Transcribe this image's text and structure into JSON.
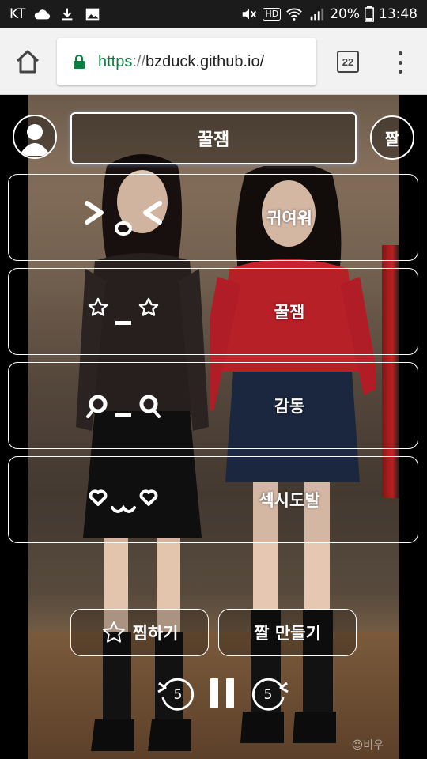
{
  "status_bar": {
    "carrier": "KT",
    "battery": "20%",
    "time": "13:48",
    "hd_badge": "HD",
    "icons_left": [
      "cloud-icon",
      "download-icon",
      "image-icon"
    ],
    "icons_right": [
      "mute-icon",
      "hd-icon",
      "wifi-icon",
      "signal-icon",
      "battery-icon"
    ]
  },
  "browser": {
    "url_scheme": "https",
    "url_sep": "://",
    "url_host": "bzduck.github.io/",
    "tab_count": "22"
  },
  "app": {
    "title": "꿀잼",
    "zzal_button": "짤",
    "categories": [
      {
        "emoticon": "happy-squint",
        "label": "귀여워"
      },
      {
        "emoticon": "star-eyes",
        "label": "꿀잼"
      },
      {
        "emoticon": "teary-eyes",
        "label": "감동"
      },
      {
        "emoticon": "heart-eyes",
        "label": "섹시도발"
      }
    ],
    "favorite_button": "찜하기",
    "make_zzal_button": "짤 만들기",
    "rewind_seconds": "5",
    "forward_seconds": "5"
  },
  "video": {
    "watermark": "☺비우"
  },
  "colors": {
    "url_scheme": "#0b8043",
    "overlay_border": "#ffffff",
    "title_glow": "#8cb4ff"
  }
}
